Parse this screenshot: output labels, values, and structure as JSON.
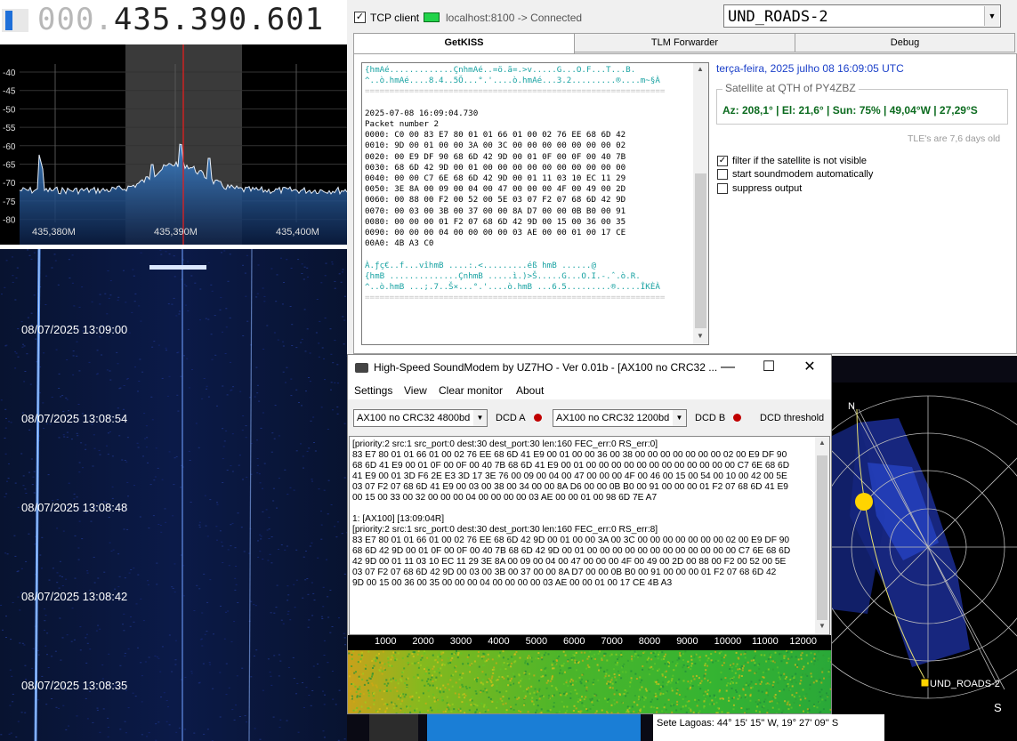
{
  "sdr": {
    "freq_dim": "000.",
    "freq_main": "435.390.601",
    "db_labels": [
      "-40",
      "-45",
      "-50",
      "-55",
      "-60",
      "-65",
      "-70",
      "-75",
      "-80"
    ],
    "freq_ticks": [
      "435,380M",
      "435,390M",
      "435,400M"
    ],
    "timestamps": [
      "08/07/2025 13:09:00",
      "08/07/2025 13:08:54",
      "08/07/2025 13:08:48",
      "08/07/2025 13:08:42",
      "08/07/2025 13:08:35"
    ]
  },
  "getkiss": {
    "tcp_label": "TCP client",
    "connection": "localhost:8100 -> Connected",
    "satellite": "UND_ROADS-2",
    "tabs": [
      "GetKISS",
      "TLM Forwarder",
      "Debug"
    ],
    "hex_lines": [
      "{hmAé.............ÇnhmAé..=ö.ã=.>v.....G...O.F...T...B.",
      "^..ò.hmAé....8.4..5Ö...°.'....ò.hmAé...3.2.........®....m~§À",
      "=============================================================",
      "",
      "2025-07-08 16:09:04.730",
      "Packet number 2",
      "0000: C0 00 83 E7 80 01 01 66 01 00 02 76 EE 68 6D 42",
      "0010: 9D 00 01 00 00 3A 00 3C 00 00 00 00 00 00 00 02",
      "0020: 00 E9 DF 90 68 6D 42 9D 00 01 0F 00 0F 00 40 7B",
      "0030: 68 6D 42 9D 00 01 00 00 00 00 00 00 00 00 00 00",
      "0040: 00 00 C7 6E 68 6D 42 9D 00 01 11 03 10 EC 11 29",
      "0050: 3E 8A 00 09 00 04 00 47 00 00 00 4F 00 49 00 2D",
      "0060: 00 88 00 F2 00 52 00 5E 03 07 F2 07 68 6D 42 9D",
      "0070: 00 03 00 3B 00 37 00 00 8A D7 00 00 0B B0 00 91",
      "0080: 00 00 00 01 F2 07 68 6D 42 9D 00 15 00 36 00 35",
      "0090: 00 00 00 04 00 00 00 00 03 AE 00 00 01 00 17 CE",
      "00A0: 4B A3 C0",
      "",
      "À.ƒç€..f...vîhmB ....:.<.........éß hmB ......@",
      "{hmB ..............ÇnhmB .....ì.)>Š.....G...O.I.-.ˆ.ò.R.",
      "^..ò.hmB ...;.7..Š×...°.'....ò.hmB ...6.5.........®.....ÎKÈÀ",
      "============================================================="
    ],
    "date": "terça-feira, 2025 julho 08  16:09:05 UTC",
    "sat_group_title": "Satellite at QTH of PY4ZBZ",
    "sat_info": "Az: 208,1° | El: 21,6° | Sun: 75% | 49,04°W | 27,29°S",
    "tle_age": "TLE's are 7,6 days old",
    "options": [
      {
        "label": "filter if the satellite is not visible",
        "checked": true
      },
      {
        "label": "start soundmodem automatically",
        "checked": false
      },
      {
        "label": "suppress output",
        "checked": false
      }
    ]
  },
  "soundmodem": {
    "title": "High-Speed SoundModem by UZ7HO - Ver 0.01b - [AX100 no CRC32 ...",
    "menu": [
      "Settings",
      "View",
      "Clear monitor",
      "About"
    ],
    "modem_a": "AX100 no CRC32 4800bd",
    "dcd_a": "DCD A",
    "modem_b": "AX100 no CRC32 1200bd",
    "dcd_b": "DCD B",
    "dcd_threshold": "DCD threshold",
    "led_color": "#c00000",
    "monitor_lines": [
      "[priority:2 src:1 src_port:0 dest:30 dest_port:30 len:160 FEC_err:0 RS_err:0]",
      "83 E7 80 01 01 66 01 00 02 76 EE 68 6D 41 E9 00 01 00 00 36 00 38 00 00 00 00 00 00 00 02 00 E9 DF 90",
      "68 6D 41 E9 00 01 0F 00 0F 00 40 7B 68 6D 41 E9 00 01 00 00 00 00 00 00 00 00 00 00 00 00 C7 6E 68 6D",
      "41 E9 00 01 3D F6 2E E3 3D 17 3E 76 00 09 00 04 00 47 00 00 00 4F 00 46 00 15 00 54 00 10 00 42 00 5E",
      "03 07 F2 07 68 6D 41 E9 00 03 00 38 00 34 00 00 8A D6 00 00 0B B0 00 91 00 00 00 01 F2 07 68 6D 41 E9",
      "00 15 00 33 00 32 00 00 00 04 00 00 00 00 03 AE 00 00 01 00 98 6D 7E A7",
      "",
      "1: [AX100] [13:09:04R]",
      "[priority:2 src:1 src_port:0 dest:30 dest_port:30 len:160 FEC_err:0 RS_err:8]",
      "83 E7 80 01 01 66 01 00 02 76 EE 68 6D 42 9D 00 01 00 00 3A 00 3C 00 00 00 00 00 00 00 02 00 E9 DF 90",
      "68 6D 42 9D 00 01 0F 00 0F 00 40 7B 68 6D 42 9D 00 01 00 00 00 00 00 00 00 00 00 00 00 00 C7 6E 68 6D",
      "42 9D 00 01 11 03 10 EC 11 29 3E 8A 00 09 00 04 00 47 00 00 00 4F 00 49 00 2D 00 88 00 F2 00 52 00 5E",
      "03 07 F2 07 68 6D 42 9D 00 03 00 3B 00 37 00 00 8A D7 00 00 0B B0 00 91 00 00 00 01 F2 07 68 6D 42",
      "9D 00 15 00 36 00 35 00 00 00 04 00 00 00 00 03 AE 00 00 01 00 17 CE 4B A3"
    ],
    "ruler": [
      "1000",
      "2000",
      "3000",
      "4000",
      "5000",
      "6000",
      "7000",
      "8000",
      "9000",
      "10000",
      "11000",
      "12000"
    ]
  },
  "polar": {
    "north": "N",
    "south": "S",
    "sat_label": "UND_ROADS-2",
    "location": "Sete Lagoas: 44° 15' 15'' W, 19° 27' 09'' S"
  }
}
